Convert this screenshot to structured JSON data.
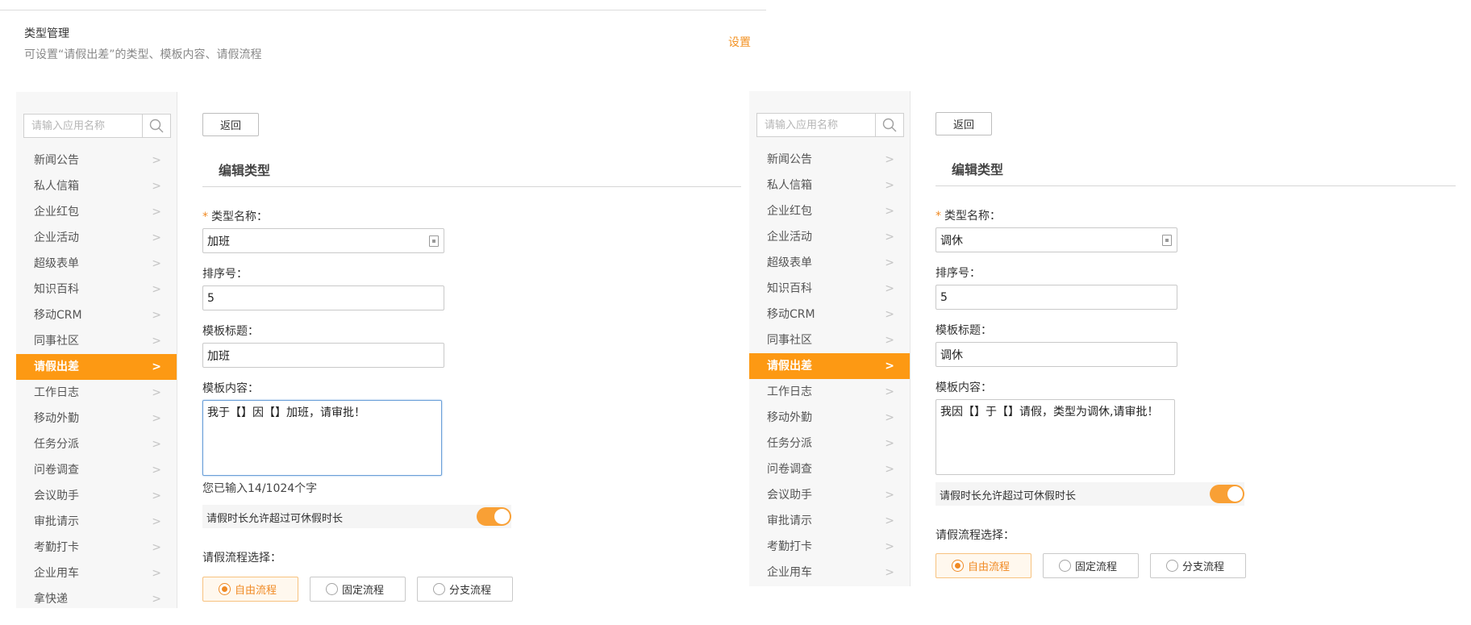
{
  "header": {
    "title": "类型管理",
    "description": "可设置“请假出差”的类型、模板内容、请假流程",
    "setting_link": "设置"
  },
  "search_placeholder": "请输入应用名称",
  "menu_left": [
    "新闻公告",
    "私人信箱",
    "企业红包",
    "企业活动",
    "超级表单",
    "知识百科",
    "移动CRM",
    "同事社区",
    "请假出差",
    "工作日志",
    "移动外勤",
    "任务分派",
    "问卷调查",
    "会议助手",
    "审批请示",
    "考勤打卡",
    "企业用车",
    "拿快递"
  ],
  "menu_right": [
    "新闻公告",
    "私人信箱",
    "企业红包",
    "企业活动",
    "超级表单",
    "知识百科",
    "移动CRM",
    "同事社区",
    "请假出差",
    "工作日志",
    "移动外勤",
    "任务分派",
    "问卷调查",
    "会议助手",
    "审批请示",
    "考勤打卡",
    "企业用车"
  ],
  "active_menu": "请假出差",
  "chevron": ">",
  "form_common": {
    "back_label": "返回",
    "section_title": "编辑类型",
    "required_mark": "*",
    "type_name_label": "类型名称：",
    "sort_label": "排序号：",
    "template_title_label": "模板标题：",
    "template_content_label": "模板内容：",
    "toggle_label": "请假时长允许超过可休假时长",
    "flow_label": "请假流程选择：",
    "flow_options": [
      "自由流程",
      "固定流程",
      "分支流程"
    ],
    "flow_selected": "自由流程",
    "accent": "#fd9913"
  },
  "left_form": {
    "type_name": "加班",
    "sort_no": "5",
    "template_title": "加班",
    "template_content": "我于【】因【】加班，请审批！",
    "counter": "您已输入14/1024个字",
    "toggle_on": true
  },
  "right_form": {
    "type_name": "调休",
    "sort_no": "5",
    "template_title": "调休",
    "template_content": "我因【】于【】请假，类型为调休,请审批！",
    "toggle_on": true
  }
}
